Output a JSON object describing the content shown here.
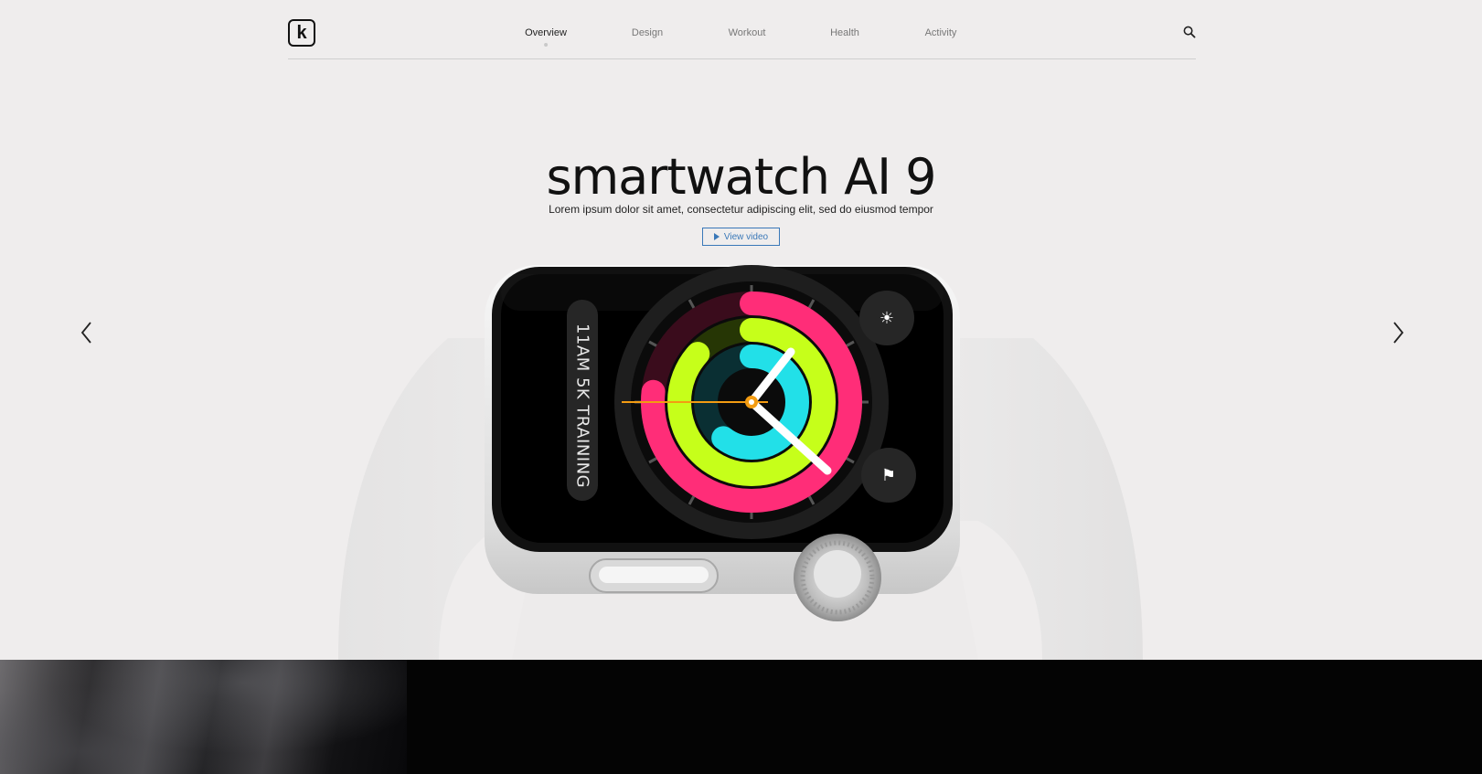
{
  "brand": {
    "logo_letter": "k"
  },
  "nav": {
    "items": [
      {
        "label": "Overview",
        "active": true
      },
      {
        "label": "Design",
        "active": false
      },
      {
        "label": "Workout",
        "active": false
      },
      {
        "label": "Health",
        "active": false
      },
      {
        "label": "Activity",
        "active": false
      }
    ]
  },
  "hero": {
    "title": "smartwatch AI 9",
    "subtitle": "Lorem ipsum dolor sit amet, consectetur adipiscing elit, sed do eiusmod tempor",
    "cta_label": "View video"
  },
  "watch_face": {
    "complication_text": "11AM 5K TRAINING"
  },
  "icons": {
    "search": "search-icon",
    "prev": "chevron-left-icon",
    "next": "chevron-right-icon",
    "play": "play-icon"
  },
  "colors": {
    "accent": "#3a78b8",
    "background": "#efeded",
    "ring_move": "#ff2d78",
    "ring_exercise": "#c6ff1a",
    "ring_stand": "#22e0e8"
  }
}
